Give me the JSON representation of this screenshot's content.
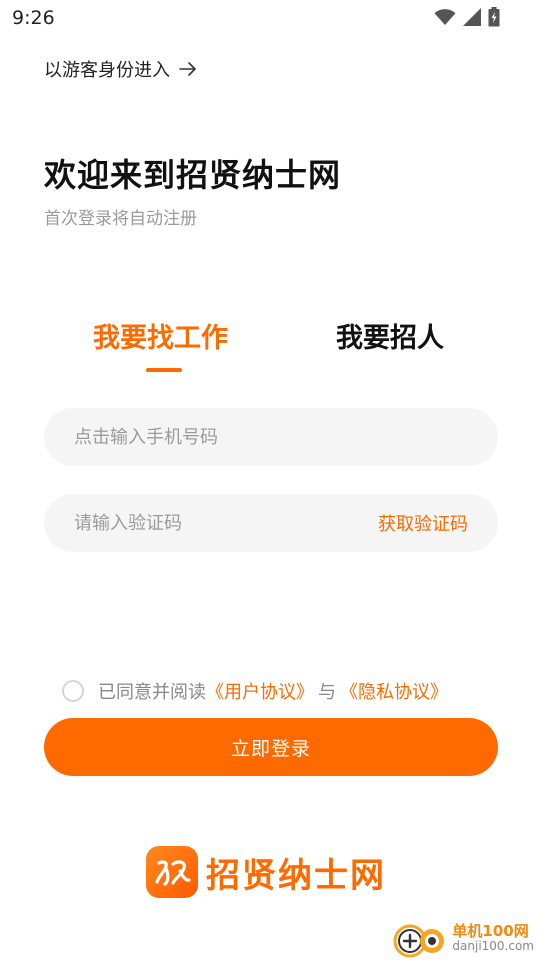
{
  "status_bar": {
    "time": "9:26",
    "icons": [
      "wifi-icon",
      "signal-icon",
      "battery-icon"
    ]
  },
  "guest": {
    "label": "以游客身份进入",
    "icon": "arrow-right-icon"
  },
  "welcome": {
    "title": "欢迎来到招贤纳士网",
    "subtitle": "首次登录将自动注册"
  },
  "tabs": [
    {
      "label": "我要找工作",
      "active": true
    },
    {
      "label": "我要招人",
      "active": false
    }
  ],
  "form": {
    "phone_placeholder": "点击输入手机号码",
    "phone_value": "",
    "code_placeholder": "请输入验证码",
    "code_value": "",
    "get_code_label": "获取验证码"
  },
  "agreement": {
    "checked": false,
    "prefix": "已同意并阅读",
    "user_link": "《用户协议》",
    "connector": "与",
    "privacy_link": "《隐私协议》"
  },
  "login_button": "立即登录",
  "brand": {
    "name": "招贤纳士网",
    "logo_icon": "brand-logo-icon"
  },
  "watermark": {
    "cn": "单机100网",
    "en": "danji100.com"
  },
  "colors": {
    "accent": "#ff6a00",
    "input_bg": "#f5f5f5",
    "muted_text": "#9a9a9a"
  }
}
